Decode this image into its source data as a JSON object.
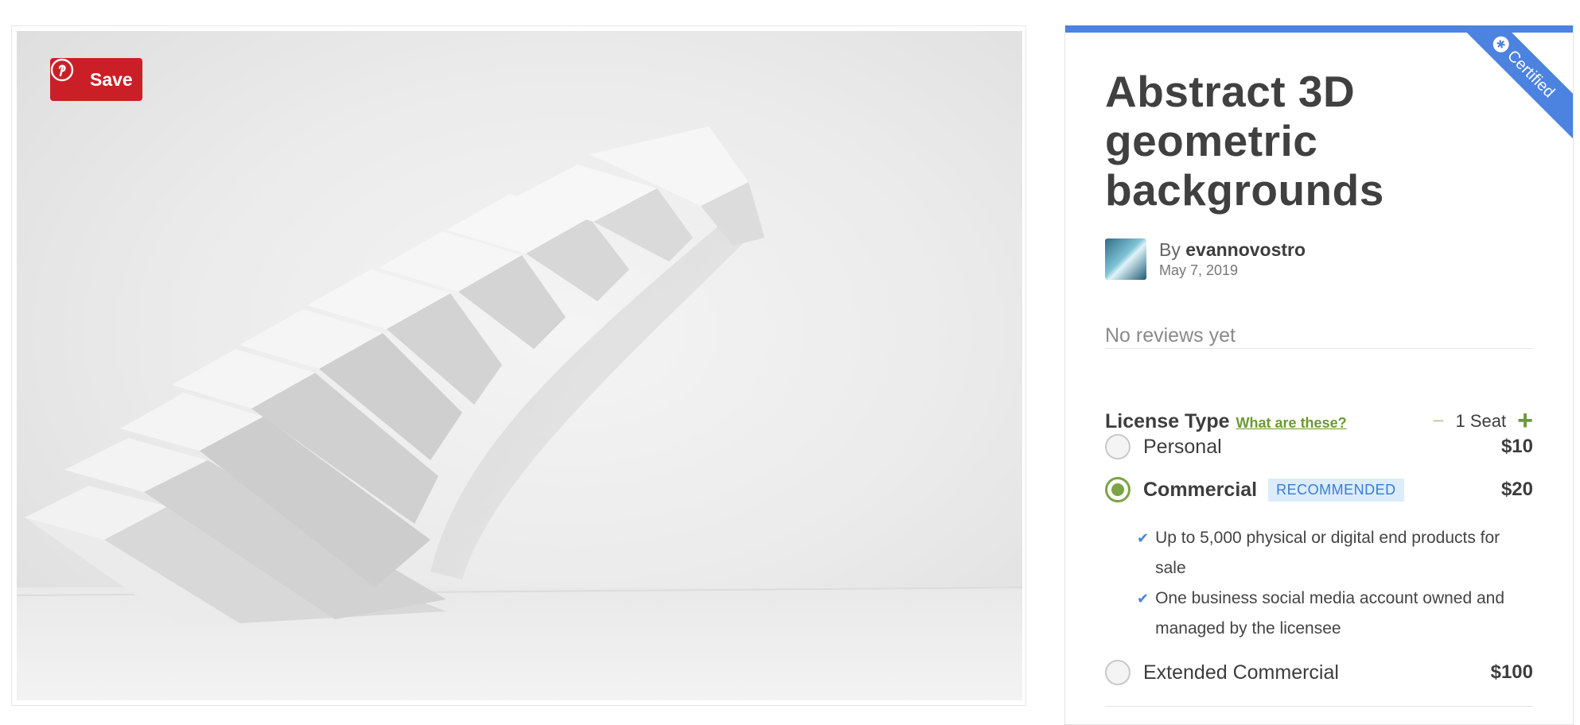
{
  "preview": {
    "pin_save_label": "Save"
  },
  "ribbon": {
    "label": "Certified",
    "icon": "badge-icon"
  },
  "product": {
    "title": "Abstract 3D geometric backgrounds",
    "by_prefix": "By",
    "author": "evannovostro",
    "date": "May 7, 2019",
    "reviews": "No reviews yet"
  },
  "license": {
    "title": "License Type",
    "help_link": "What are these?",
    "seat_minus": "−",
    "seat_value": "1 Seat",
    "seat_plus": "+",
    "options": [
      {
        "label": "Personal",
        "price": "$10",
        "selected": false
      },
      {
        "label": "Commercial",
        "price": "$20",
        "selected": true,
        "badge": "RECOMMENDED"
      },
      {
        "label": "Extended Commercial",
        "price": "$100",
        "selected": false
      }
    ],
    "features": [
      "Up to 5,000 physical or digital end products for sale",
      "One business social media account owned and managed by the licensee"
    ]
  },
  "colors": {
    "accent_blue": "#4c82e0",
    "accent_green": "#7ca346",
    "pinterest_red": "#cb1f27"
  }
}
